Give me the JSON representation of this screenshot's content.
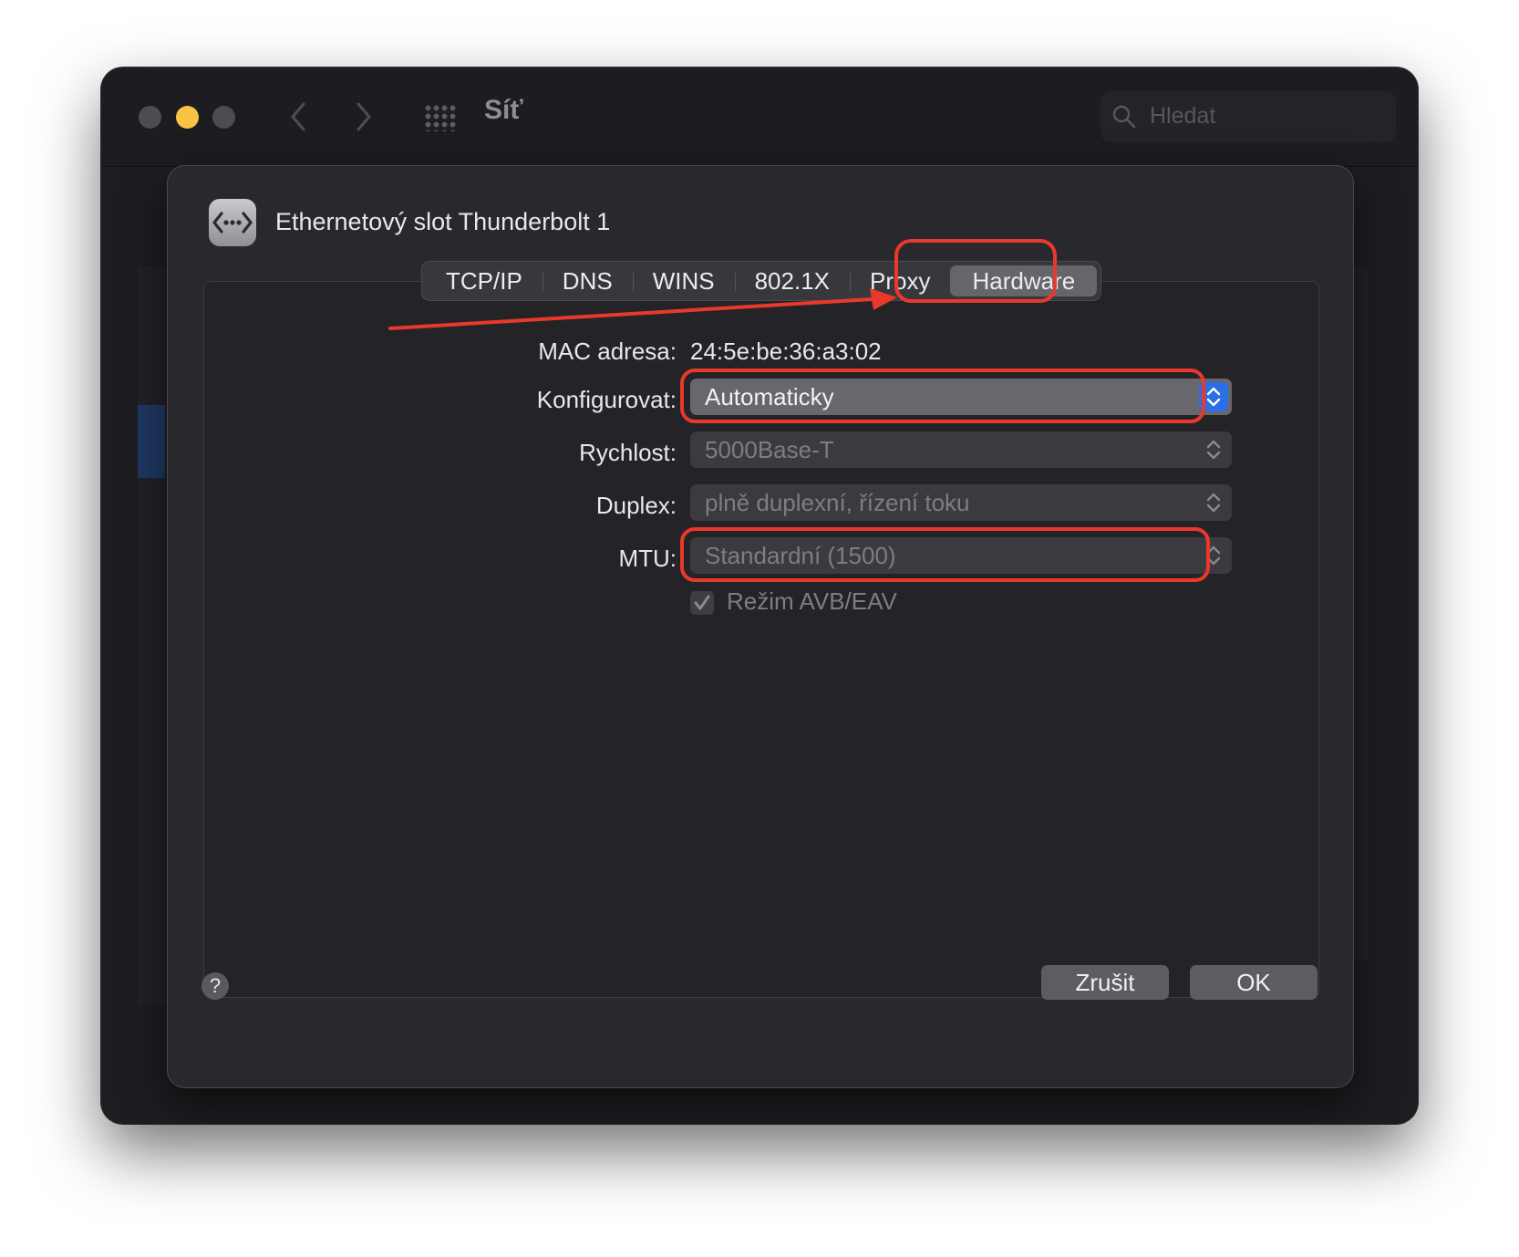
{
  "window": {
    "title": "Síť",
    "search_placeholder": "Hledat"
  },
  "sheet": {
    "interface_name": "Ethernetový slot Thunderbolt 1",
    "tabs": [
      {
        "label": "TCP/IP",
        "selected": false
      },
      {
        "label": "DNS",
        "selected": false
      },
      {
        "label": "WINS",
        "selected": false
      },
      {
        "label": "802.1X",
        "selected": false
      },
      {
        "label": "Proxy",
        "selected": false
      },
      {
        "label": "Hardware",
        "selected": true
      }
    ],
    "mac": {
      "label": "MAC adresa:",
      "value": "24:5e:be:36:a3:02"
    },
    "configure": {
      "label": "Konfigurovat:",
      "value": "Automaticky"
    },
    "speed": {
      "label": "Rychlost:",
      "value": "5000Base-T"
    },
    "duplex": {
      "label": "Duplex:",
      "value": "plně duplexní, řízení toku"
    },
    "mtu": {
      "label": "MTU:",
      "value": "Standardní (1500)"
    },
    "avb": {
      "label": "Režim AVB/EAV",
      "checked": true
    },
    "help_label": "?",
    "cancel_label": "Zrušit",
    "ok_label": "OK"
  },
  "colors": {
    "annotation": "#e8392b",
    "accent": "#2a6ee8",
    "traffic_min": "#f8c242"
  }
}
